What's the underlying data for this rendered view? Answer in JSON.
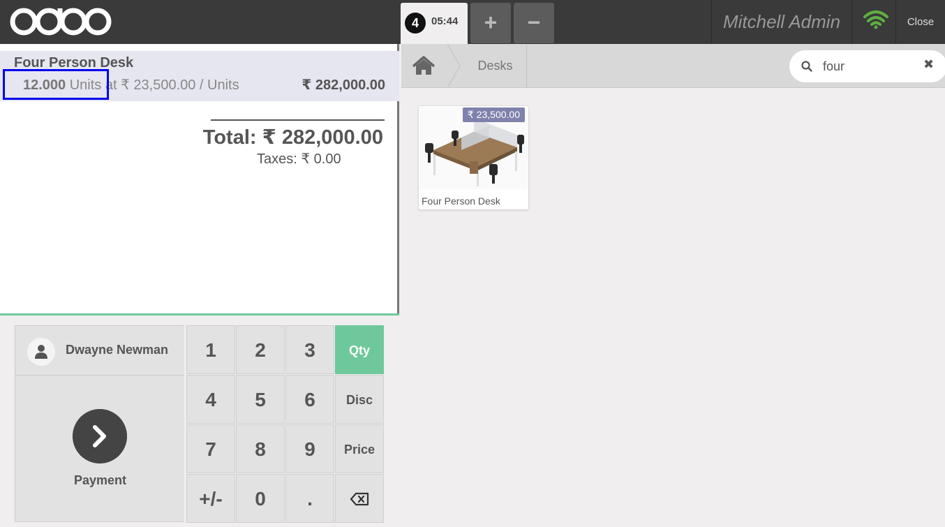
{
  "header": {
    "logo_text": "odoo",
    "order": {
      "number": "4",
      "time": "05:44"
    },
    "add_order_label": "+",
    "remove_order_label": "−",
    "cashier": "Mitchell Admin",
    "close_label": "Close",
    "wifi_color": "#5fb043"
  },
  "orderline": {
    "product_name": "Four Person Desk",
    "quantity": "12.000",
    "unit": "Units",
    "unit_price_text": "at ₹ 23,500.00 / Units",
    "line_total": "₹ 282,000.00"
  },
  "summary": {
    "total": "Total: ₹ 282,000.00",
    "taxes": "Taxes: ₹ 0.00"
  },
  "actionpad": {
    "customer": "Dwayne Newman",
    "payment_label": "Payment"
  },
  "numpad": {
    "keys": [
      "1",
      "2",
      "3",
      "4",
      "5",
      "6",
      "7",
      "8",
      "9",
      "+/-",
      "0",
      "."
    ],
    "modes": [
      "Qty",
      "Disc",
      "Price"
    ],
    "active_mode": "Qty",
    "backspace_icon": "backspace-icon"
  },
  "product_screen": {
    "breadcrumb": "Desks",
    "search_value": "four",
    "search_clear": "✖",
    "products": [
      {
        "name": "Four Person Desk",
        "price": "₹ 23,500.00"
      }
    ]
  },
  "colors": {
    "accent_green": "#6ec89b",
    "topbar": "#3a3a3a",
    "price_tag": "#7f82ac",
    "highlight_box": "#0000ee"
  }
}
